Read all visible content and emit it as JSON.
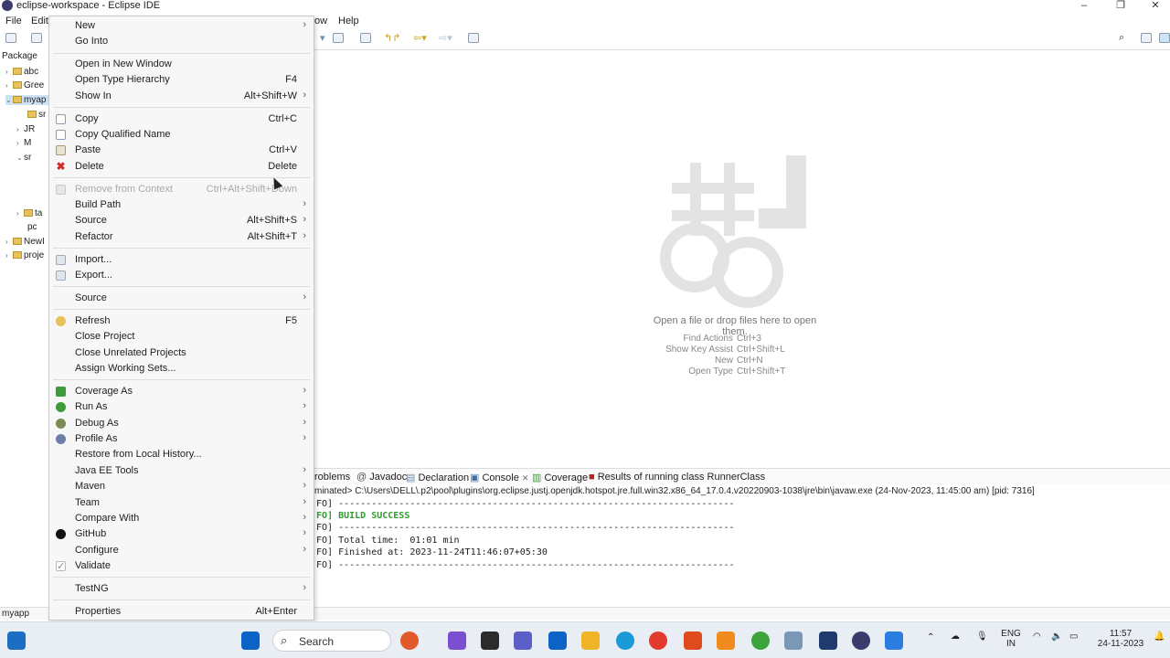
{
  "window": {
    "title": "eclipse-workspace - Eclipse IDE",
    "minimize": "–",
    "maximize": "❐",
    "close": "✕"
  },
  "menubar": {
    "file": "File",
    "edit": "Edit",
    "window_fragment": "ow",
    "help": "Help"
  },
  "package_explorer": {
    "tab_label": "Package",
    "items": [
      {
        "label": "abc"
      },
      {
        "label": "Gree"
      },
      {
        "label": "myap"
      },
      {
        "label": "sr"
      },
      {
        "label": "JR"
      },
      {
        "label": "M"
      },
      {
        "label": "sr"
      },
      {
        "label": "ta"
      },
      {
        "label": "pc"
      },
      {
        "label": "NewI"
      },
      {
        "label": "proje"
      }
    ]
  },
  "editor": {
    "hint": "Open a file or drop files here to open them.",
    "shortcuts": [
      {
        "label": "Find Actions",
        "keys": "Ctrl+3"
      },
      {
        "label": "Show Key Assist",
        "keys": "Ctrl+Shift+L"
      },
      {
        "label": "New",
        "keys": "Ctrl+N"
      },
      {
        "label": "Open Type",
        "keys": "Ctrl+Shift+T"
      }
    ]
  },
  "console": {
    "tabs": [
      "roblems",
      "Javadoc",
      "Declaration",
      "Console",
      "Coverage",
      "Results of running class RunnerClass"
    ],
    "close_glyph": "✕",
    "path": "minated> C:\\Users\\DELL\\.p2\\pool\\plugins\\org.eclipse.justj.openjdk.hotspot.jre.full.win32.x86_64_17.0.4.v20220903-1038\\jre\\bin\\javaw.exe (24-Nov-2023, 11:45:00 am) [pid: 7316]",
    "lines": [
      "FO] ------------------------------------------------------------------------",
      "FO] BUILD SUCCESS",
      "FO] ------------------------------------------------------------------------",
      "FO] Total time:  01:01 min",
      "FO] Finished at: 2023-11-24T11:46:07+05:30",
      "FO] ------------------------------------------------------------------------"
    ]
  },
  "statusbar": {
    "selection": "myapp"
  },
  "context_menu": {
    "submenu_glyph": "›",
    "items": [
      {
        "label": "New",
        "shortcut": "",
        "submenu": true
      },
      {
        "label": "Go Into",
        "shortcut": ""
      },
      {
        "label": "Open in New Window",
        "shortcut": ""
      },
      {
        "label": "Open Type Hierarchy",
        "shortcut": "F4"
      },
      {
        "label": "Show In",
        "shortcut": "Alt+Shift+W",
        "submenu": true
      },
      {
        "label": "Copy",
        "shortcut": "Ctrl+C",
        "icon": "copy-icon"
      },
      {
        "label": "Copy Qualified Name",
        "shortcut": "",
        "icon": "copy-qualified-icon"
      },
      {
        "label": "Paste",
        "shortcut": "Ctrl+V",
        "icon": "paste-icon"
      },
      {
        "label": "Delete",
        "shortcut": "Delete",
        "icon": "delete-icon"
      },
      {
        "label": "Remove from Context",
        "shortcut": "Ctrl+Alt+Shift+Down",
        "disabled": true,
        "icon": "remove-context-icon"
      },
      {
        "label": "Build Path",
        "shortcut": "",
        "submenu": true
      },
      {
        "label": "Source",
        "shortcut": "Alt+Shift+S",
        "submenu": true
      },
      {
        "label": "Refactor",
        "shortcut": "Alt+Shift+T",
        "submenu": true
      },
      {
        "label": "Import...",
        "shortcut": "",
        "icon": "import-icon"
      },
      {
        "label": "Export...",
        "shortcut": "",
        "icon": "export-icon"
      },
      {
        "label": "Source",
        "shortcut": "",
        "submenu": true
      },
      {
        "label": "Refresh",
        "shortcut": "F5",
        "icon": "refresh-icon"
      },
      {
        "label": "Close Project",
        "shortcut": ""
      },
      {
        "label": "Close Unrelated Projects",
        "shortcut": ""
      },
      {
        "label": "Assign Working Sets...",
        "shortcut": ""
      },
      {
        "label": "Coverage As",
        "shortcut": "",
        "submenu": true,
        "icon": "coverage-icon"
      },
      {
        "label": "Run As",
        "shortcut": "",
        "submenu": true,
        "icon": "run-icon"
      },
      {
        "label": "Debug As",
        "shortcut": "",
        "submenu": true,
        "icon": "debug-icon"
      },
      {
        "label": "Profile As",
        "shortcut": "",
        "submenu": true,
        "icon": "profile-icon"
      },
      {
        "label": "Restore from Local History...",
        "shortcut": ""
      },
      {
        "label": "Java EE Tools",
        "shortcut": "",
        "submenu": true
      },
      {
        "label": "Maven",
        "shortcut": "",
        "submenu": true
      },
      {
        "label": "Team",
        "shortcut": "",
        "submenu": true
      },
      {
        "label": "Compare With",
        "shortcut": "",
        "submenu": true
      },
      {
        "label": "GitHub",
        "shortcut": "",
        "submenu": true,
        "icon": "github-icon"
      },
      {
        "label": "Configure",
        "shortcut": "",
        "submenu": true
      },
      {
        "label": "Validate",
        "shortcut": "",
        "icon": "validate-icon"
      },
      {
        "label": "TestNG",
        "shortcut": "",
        "submenu": true
      },
      {
        "label": "Properties",
        "shortcut": "Alt+Enter"
      }
    ]
  },
  "taskbar": {
    "search_placeholder": "Search",
    "lang_line1": "ENG",
    "lang_line2": "IN",
    "time": "11:57",
    "date": "24-11-2023"
  },
  "colors": {
    "accent": "#0b63c5",
    "build_success": "#2e9e2e",
    "delete_icon": "#d12b2b"
  }
}
